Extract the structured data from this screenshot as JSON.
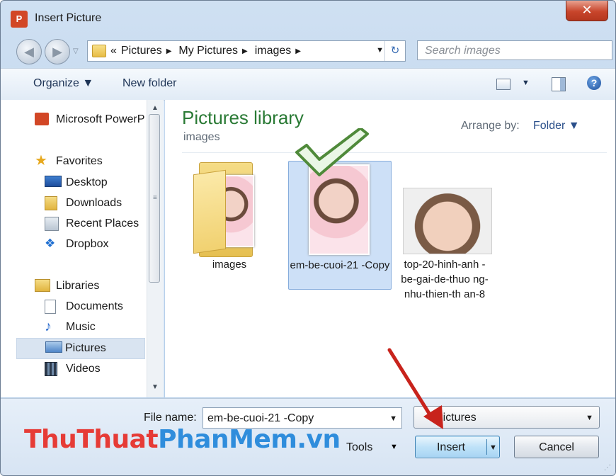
{
  "window": {
    "title": "Insert Picture",
    "close_glyph": "✕",
    "app_icon_text": "P"
  },
  "nav": {
    "back_glyph": "◀",
    "forward_glyph": "▶",
    "history_drop": "▽"
  },
  "address": {
    "overflow": "«",
    "crumbs": [
      "Pictures",
      "My Pictures",
      "images"
    ],
    "sep": "▶",
    "drop": "▼",
    "refresh_glyph": "↻"
  },
  "search": {
    "placeholder": "Search images"
  },
  "toolbar": {
    "organize": "Organize ▼",
    "new_folder": "New folder",
    "view_drop": "▼",
    "help": "?"
  },
  "navpane": {
    "items": [
      {
        "label": "Microsoft PowerP",
        "icon": "powerpoint-icon"
      },
      {
        "label": "Favorites",
        "icon": "star-icon"
      },
      {
        "label": "Desktop",
        "icon": "desktop-icon"
      },
      {
        "label": "Downloads",
        "icon": "downloads-icon"
      },
      {
        "label": "Recent Places",
        "icon": "recent-places-icon"
      },
      {
        "label": "Dropbox",
        "icon": "dropbox-icon"
      },
      {
        "label": "Libraries",
        "icon": "libraries-icon"
      },
      {
        "label": "Documents",
        "icon": "documents-icon"
      },
      {
        "label": "Music",
        "icon": "music-icon"
      },
      {
        "label": "Pictures",
        "icon": "pictures-icon"
      },
      {
        "label": "Videos",
        "icon": "videos-icon"
      }
    ],
    "selected": "Pictures",
    "scroll_up": "▲",
    "scroll_down": "▼",
    "grip": "≡"
  },
  "content": {
    "library_title": "Pictures library",
    "library_sub": "images",
    "arrange_label": "Arrange by:",
    "arrange_value": "Folder ▼",
    "files": [
      {
        "name": "images",
        "type": "folder"
      },
      {
        "name": "em-be-cuoi-21 -Copy",
        "type": "image",
        "selected": true
      },
      {
        "name": "top-20-hinh-anh -be-gai-de-thuo ng-nhu-thien-th an-8",
        "type": "image"
      }
    ]
  },
  "bottom": {
    "file_name_label": "File name:",
    "file_name_value": "em-be-cuoi-21 -Copy",
    "file_type_value": "Pictures",
    "drop": "▼",
    "tools_label": "Tools",
    "insert_label": "Insert",
    "cancel_label": "Cancel",
    "grip": "⋰"
  },
  "watermark": {
    "part1": "ThuThuat",
    "part2": "PhanMem.vn"
  },
  "colors": {
    "library_title": "#2a7a35",
    "selection": "#cde0f7",
    "watermark_red": "#e63b36",
    "watermark_blue": "#2f8ddc",
    "arrow": "#c8231c"
  }
}
